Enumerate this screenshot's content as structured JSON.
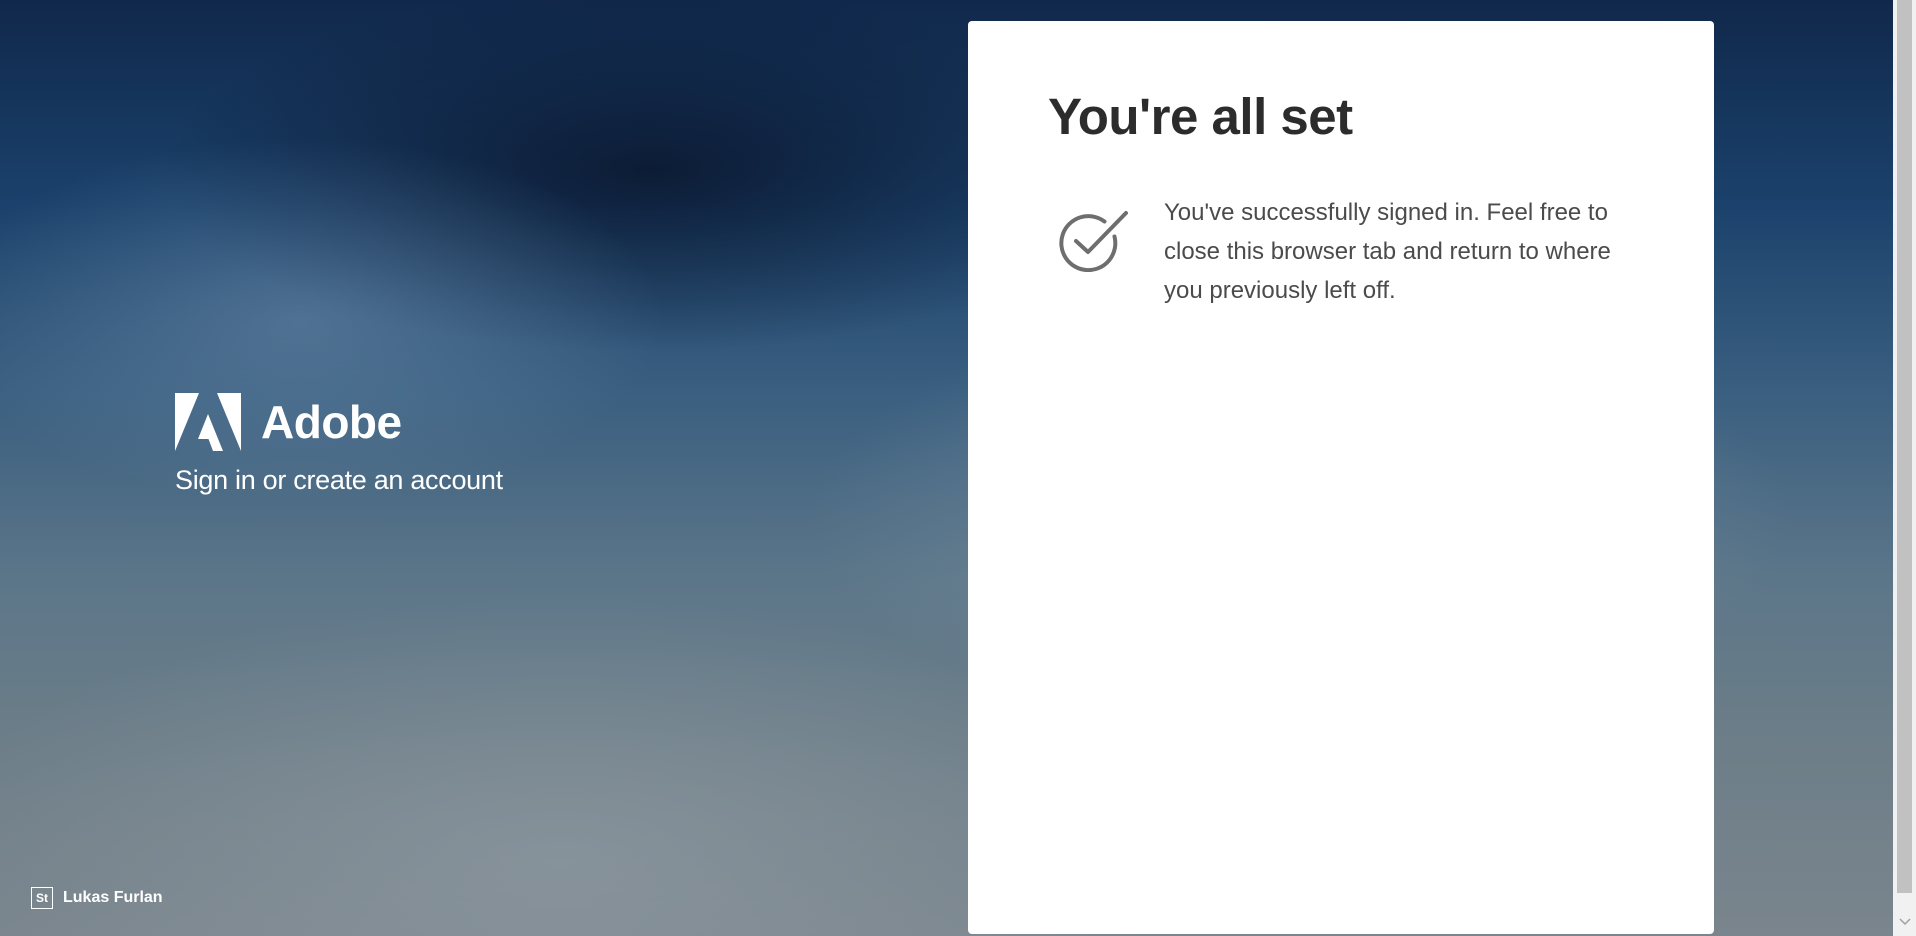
{
  "brand": {
    "name": "Adobe",
    "subtitle": "Sign in or create an account"
  },
  "card": {
    "title": "You're all set",
    "message": "You've successfully signed in. Feel free to close this browser tab and return to where you previously left off.",
    "icon": "checkmark-circle-icon"
  },
  "credit": {
    "badge": "St",
    "name": "Lukas Furlan"
  },
  "colors": {
    "card_background": "#ffffff",
    "title_text": "#2c2c2c",
    "body_text": "#4b4b4b",
    "icon": "#6e6e6e"
  }
}
